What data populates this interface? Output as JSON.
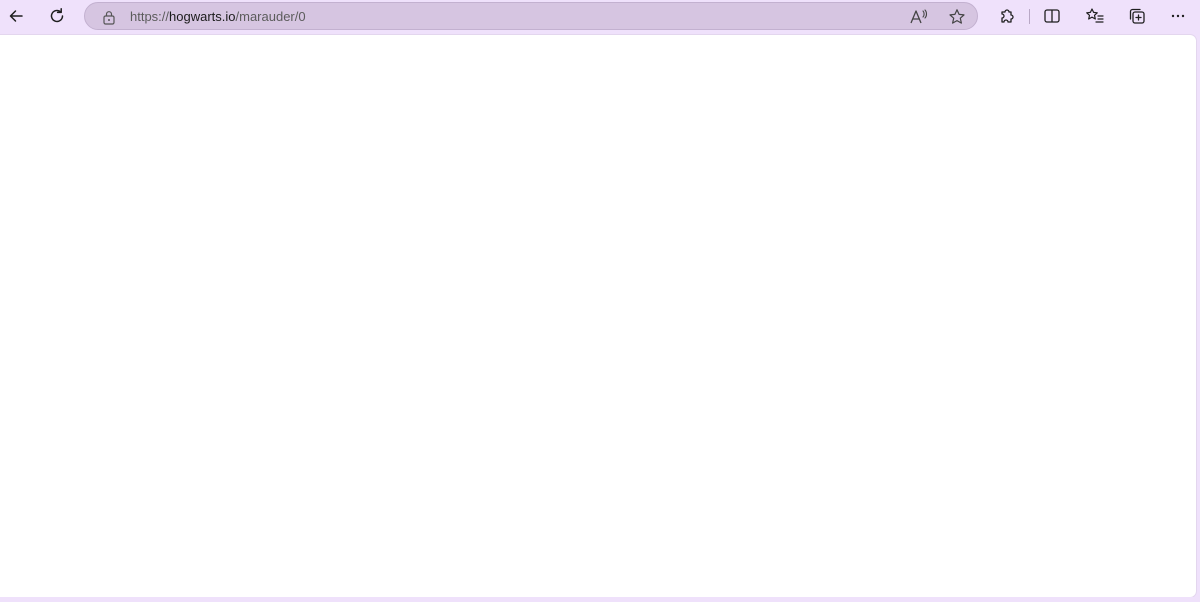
{
  "browser": {
    "url": {
      "scheme": "https://",
      "host": "hogwarts.io",
      "path": "/marauder/0"
    },
    "icons": {
      "back": "arrow-left-icon",
      "refresh": "refresh-icon",
      "lock": "lock-icon",
      "read_aloud": "read-aloud-icon",
      "favorite": "star-icon",
      "extensions": "puzzle-icon",
      "split_screen": "split-screen-icon",
      "favorites": "favorites-list-icon",
      "collections": "collections-icon",
      "more": "more-icon"
    },
    "colors": {
      "frame": "#efe1fb",
      "address_bar": "#d6c5e1",
      "content": "#ffffff"
    }
  }
}
